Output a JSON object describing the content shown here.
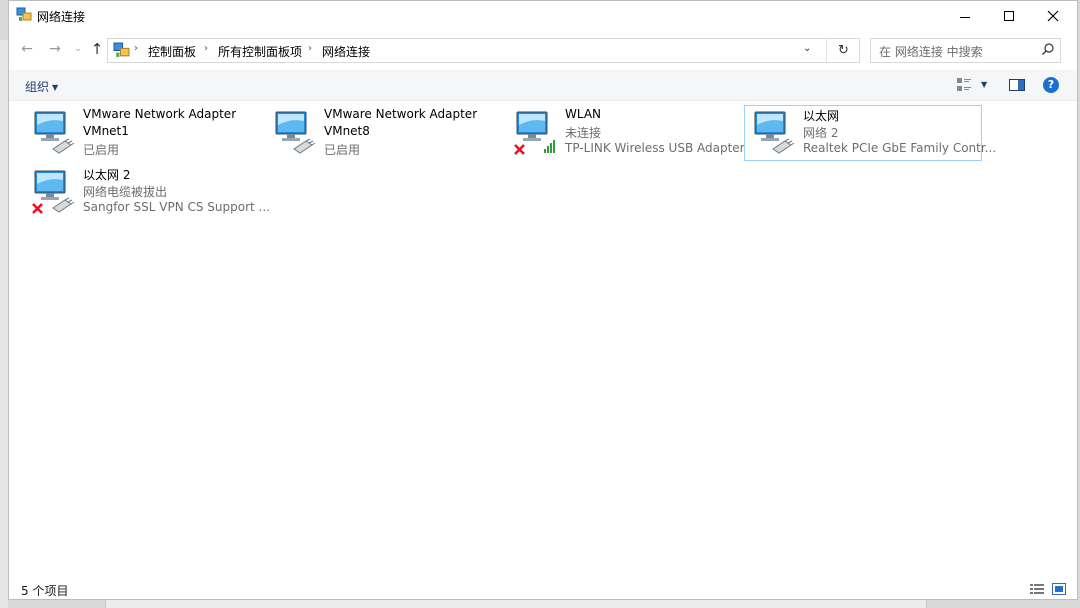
{
  "window": {
    "title": "网络连接"
  },
  "nav": {
    "breadcrumb": [
      "控制面板",
      "所有控制面板项",
      "网络连接"
    ],
    "search_placeholder": "在 网络连接 中搜索"
  },
  "command_bar": {
    "organize_label": "组织"
  },
  "items": [
    {
      "name": "VMware Network Adapter",
      "line2": "VMnet1",
      "line3": "已启用",
      "status": "enabled",
      "selected": false
    },
    {
      "name": "VMware Network Adapter",
      "line2": "VMnet8",
      "line3": "已启用",
      "status": "enabled",
      "selected": false
    },
    {
      "name": "WLAN",
      "line2": "未连接",
      "line3": "TP-LINK Wireless USB Adapter",
      "status": "wireless-disconnected",
      "selected": false
    },
    {
      "name": "以太网",
      "line2": "网络 2",
      "line3": "Realtek PCIe GbE Family Contr...",
      "status": "connected",
      "selected": true
    },
    {
      "name": "以太网 2",
      "line2": "网络电缆被拔出",
      "line3": "Sangfor SSL VPN CS Support ...",
      "status": "unplugged",
      "selected": false
    }
  ],
  "status_bar": {
    "count_text": "5 个项目"
  },
  "colors": {
    "accent": "#1a6fd3",
    "selection_border": "#99d1ff",
    "error_red": "#e81123",
    "signal_green": "#2e9e3a"
  }
}
